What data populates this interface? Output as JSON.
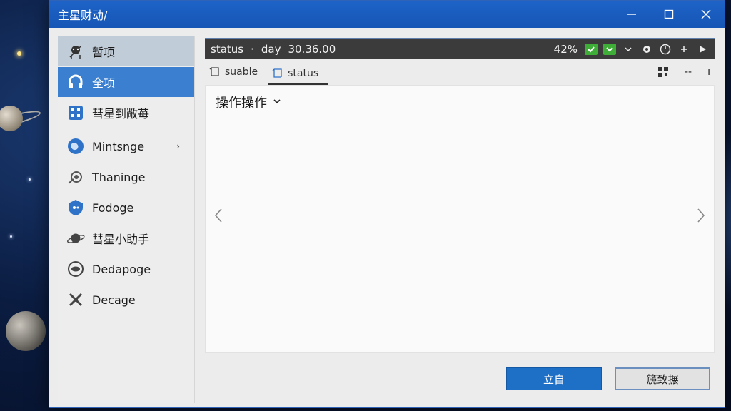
{
  "window": {
    "title": "主星财动/",
    "minimize_icon": "minimize-icon",
    "maximize_icon": "maximize-icon",
    "close_icon": "close-icon"
  },
  "sidebar": {
    "items": [
      {
        "label": "暂项",
        "icon": "robot-icon"
      },
      {
        "label": "全项",
        "icon": "headphones-icon"
      },
      {
        "label": "彗星到敞苺",
        "icon": "grid-icon"
      },
      {
        "label": "Mintsnge",
        "icon": "globe-icon"
      },
      {
        "label": "Thaninge",
        "icon": "satellite-icon"
      },
      {
        "label": "Fodoge",
        "icon": "shield-icon"
      },
      {
        "label": "彗星小助手",
        "icon": "planet-icon"
      },
      {
        "label": "Dedapoge",
        "icon": "eye-icon"
      },
      {
        "label": "Decage",
        "icon": "cross-icon"
      }
    ]
  },
  "statusbar": {
    "label": "status",
    "separator": "·",
    "day_label": "day",
    "time": "30.36.00",
    "percent": "42%"
  },
  "tabs": [
    {
      "label": "suable",
      "icon": "square-icon"
    },
    {
      "label": "status",
      "icon": "square-icon"
    }
  ],
  "toolbar": {
    "qr": "qr-icon",
    "dash": "--",
    "more": "ı"
  },
  "content": {
    "dropdown_label": "操作操作"
  },
  "buttons": {
    "primary_label": "立自",
    "secondary_label": "篪致搌"
  },
  "colors": {
    "titlebar": "#1e63c8",
    "accent": "#3a7fd0",
    "status_green": "#3fae39",
    "statusbar_bg": "#3b3b3b"
  }
}
